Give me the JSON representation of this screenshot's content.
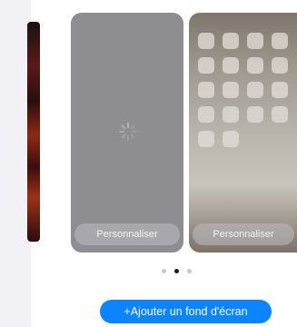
{
  "wallpapers": {
    "lock_screen": {
      "customize_label": "Personnaliser",
      "state": "loading"
    },
    "home_screen": {
      "customize_label": "Personnaliser",
      "app_icon_count": 18
    }
  },
  "pager": {
    "total": 3,
    "active_index": 1
  },
  "actions": {
    "add_wallpaper_label": "+Ajouter un fond d'écran"
  },
  "colors": {
    "accent": "#0a84ff",
    "lock_card": "#8d8d92",
    "active_dot": "#1c1c1e",
    "inactive_dot": "#c7c7cc"
  },
  "icons": {
    "loading": "spinner-icon"
  }
}
